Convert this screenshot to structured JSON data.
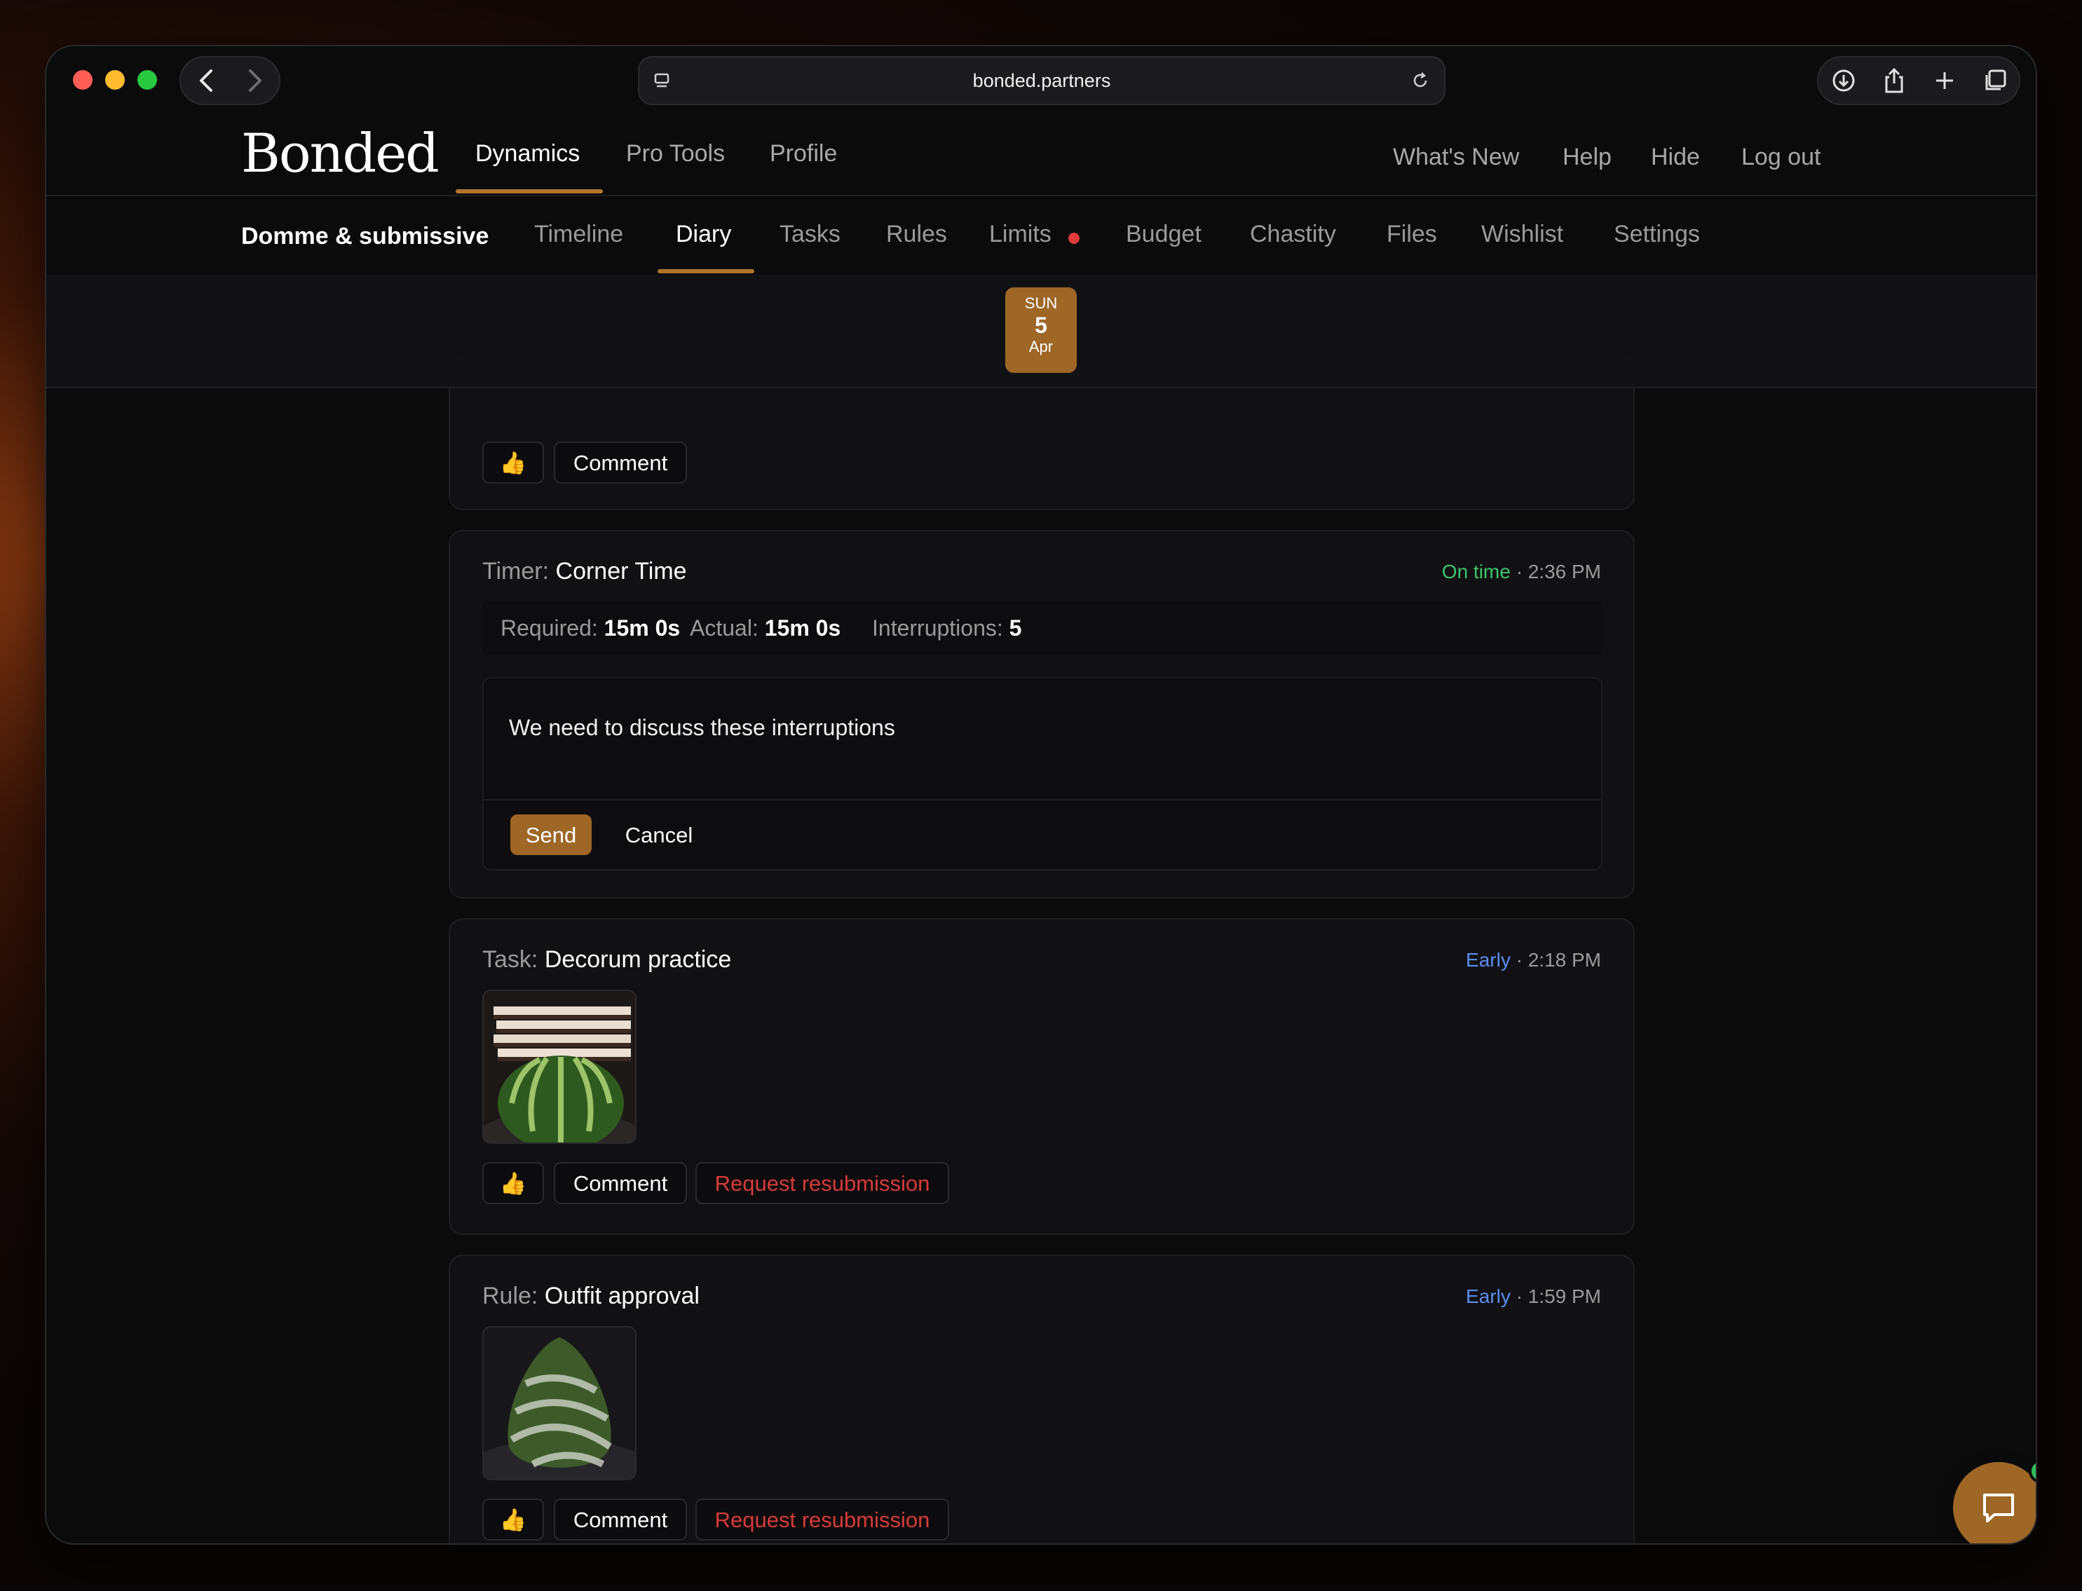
{
  "browser": {
    "url": "bonded.partners"
  },
  "header": {
    "logo": "Bonded",
    "main_nav": [
      "Dynamics",
      "Pro Tools",
      "Profile"
    ],
    "right_nav": [
      "What's New",
      "Help",
      "Hide",
      "Log out"
    ],
    "dynamic_name": "Domme & submissive",
    "sub_nav": [
      "Timeline",
      "Diary",
      "Tasks",
      "Rules",
      "Limits",
      "Budget",
      "Chastity",
      "Files",
      "Wishlist",
      "Settings"
    ],
    "active_main": "Dynamics",
    "active_sub": "Diary"
  },
  "date_chip": {
    "dow": "SUN",
    "day": "5",
    "month": "Apr"
  },
  "top_card": {
    "thumb": "👍",
    "comment": "Comment"
  },
  "timer_card": {
    "kind": "Timer:",
    "title": "Corner Time",
    "status": "On time",
    "time": "· 2:36 PM",
    "required_label": "Required:",
    "required_value": "15m 0s",
    "actual_label": "Actual:",
    "actual_value": "15m 0s",
    "interruptions_label": "Interruptions:",
    "interruptions_value": "5",
    "comment_text": "We need to discuss these interruptions",
    "send": "Send",
    "cancel": "Cancel"
  },
  "task_card": {
    "kind": "Task:",
    "title": "Decorum practice",
    "status": "Early",
    "time": "· 2:18 PM",
    "thumb": "👍",
    "comment": "Comment",
    "resubmit": "Request resubmission"
  },
  "rule_card": {
    "kind": "Rule:",
    "title": "Outfit approval",
    "status": "Early",
    "time": "· 1:59 PM",
    "thumb": "👍",
    "comment": "Comment",
    "resubmit": "Request resubmission"
  },
  "colors": {
    "accent": "#9e6726",
    "on_time": "#3ec46d",
    "early": "#5b8def",
    "danger": "#d83a3a",
    "notification_dot": "#e23b3b"
  },
  "icons": [
    "back-icon",
    "forward-icon",
    "reader-icon",
    "reload-icon",
    "download-icon",
    "share-icon",
    "new-tab-icon",
    "tabs-icon",
    "chat-icon"
  ]
}
